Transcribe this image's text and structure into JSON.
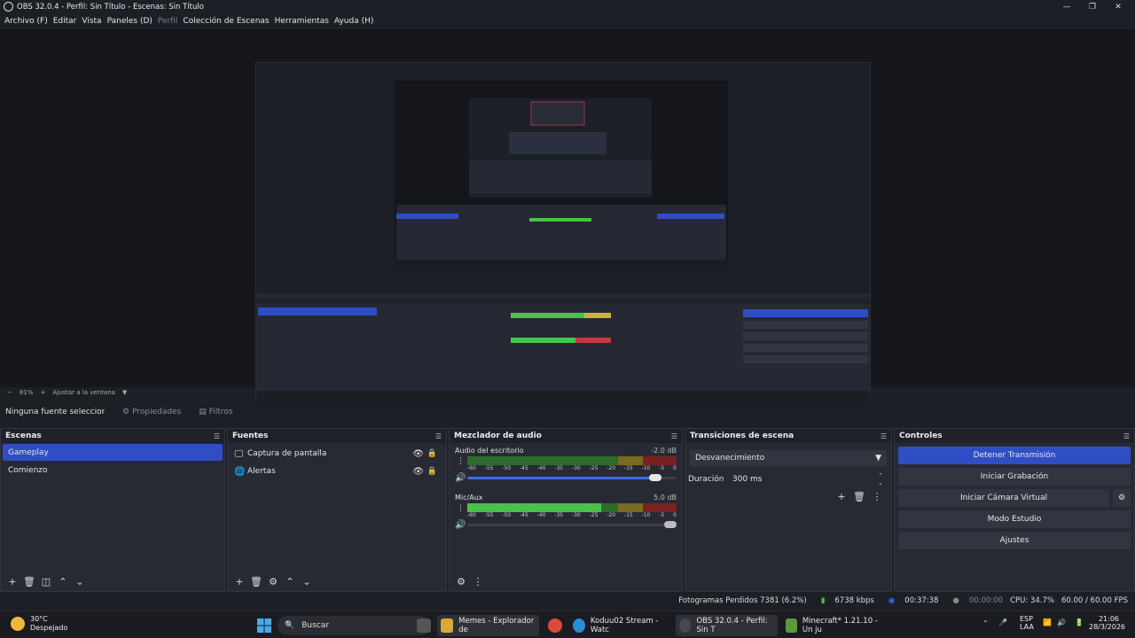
{
  "window": {
    "title": "OBS 32.0.4 - Perfil: Sin Título - Escenas: Sin Título",
    "minimize": "—",
    "maximize": "❐",
    "close": "✕"
  },
  "menu": [
    {
      "label": "Archivo (F)",
      "disabled": false
    },
    {
      "label": "Editar",
      "disabled": false
    },
    {
      "label": "Vista",
      "disabled": false
    },
    {
      "label": "Paneles (D)",
      "disabled": false
    },
    {
      "label": "Perfil",
      "disabled": true
    },
    {
      "label": "Colección de Escenas",
      "disabled": false
    },
    {
      "label": "Herramientas",
      "disabled": false
    },
    {
      "label": "Ayuda (H)",
      "disabled": false
    }
  ],
  "zoom": {
    "minus": "−",
    "value": "81%",
    "plus": "+",
    "fit_label": "Ajustar a la ventana"
  },
  "source_toolbar": {
    "no_source": "Ninguna fuente seleccionada",
    "properties": "Propiedades",
    "filters": "Filtros"
  },
  "scenes": {
    "title": "Escenas",
    "items": [
      "Gameplay",
      "Comienzo"
    ],
    "active_index": 0
  },
  "sources": {
    "title": "Fuentes",
    "items": [
      {
        "label": "Captura de pantalla",
        "icon": "monitor-icon"
      },
      {
        "label": "Alertas",
        "icon": "globe-icon"
      }
    ]
  },
  "mixer": {
    "title": "Mezclador de audio",
    "channels": [
      {
        "name": "Audio del escritorio",
        "db": "-2.0 dB",
        "level": 0,
        "volume": 0.93
      },
      {
        "name": "Mic/Aux",
        "db": "5.0 dB",
        "level": 0.64,
        "volume": 1.0
      }
    ],
    "scale": [
      "-60",
      "-55",
      "-50",
      "-45",
      "-40",
      "-35",
      "-30",
      "-25",
      "-20",
      "-15",
      "-10",
      "-5",
      "0"
    ]
  },
  "transitions": {
    "title": "Transiciones de escena",
    "selected": "Desvanecimiento",
    "duration_label": "Duración",
    "duration_value": "300 ms"
  },
  "controls": {
    "title": "Controles",
    "buttons": [
      "Detener Transmisión",
      "Iniciar Grabación",
      "Iniciar Cámara Virtual",
      "Modo Estudio",
      "Ajustes"
    ]
  },
  "status": {
    "dropped": "Fotogramas Perdidos 7381 (6.2%)",
    "bitrate": "6738 kbps",
    "stream_time": "00:37:38",
    "rec_time": "00:00:00",
    "cpu": "CPU: 34.7%",
    "fps": "60.00 / 60.00 FPS"
  },
  "taskbar": {
    "temp": "30°C",
    "weather": "Despejado",
    "search": "Buscar",
    "apps": [
      {
        "label": "Memes - Explorador de",
        "color": "#d9a73a"
      },
      {
        "label": "Koduu02 Stream - Watc",
        "color": "#2a8bd8"
      },
      {
        "label": "OBS 32.0.4 - Perfil: Sin T",
        "color": "#444a55"
      },
      {
        "label": "Minecraft* 1.21.10 - Un ju",
        "color": "#5b9b3a"
      }
    ],
    "lang1": "ESP",
    "lang2": "LAA",
    "time": "21:06",
    "date": "28/3/2026"
  },
  "colors": {
    "accent": "#2f4ec4",
    "panel": "#272a33",
    "background": "#1d1f26",
    "meter_green": "#4ac24a",
    "meter_yellow": "#c4b53a",
    "meter_red": "#c43a3a"
  }
}
